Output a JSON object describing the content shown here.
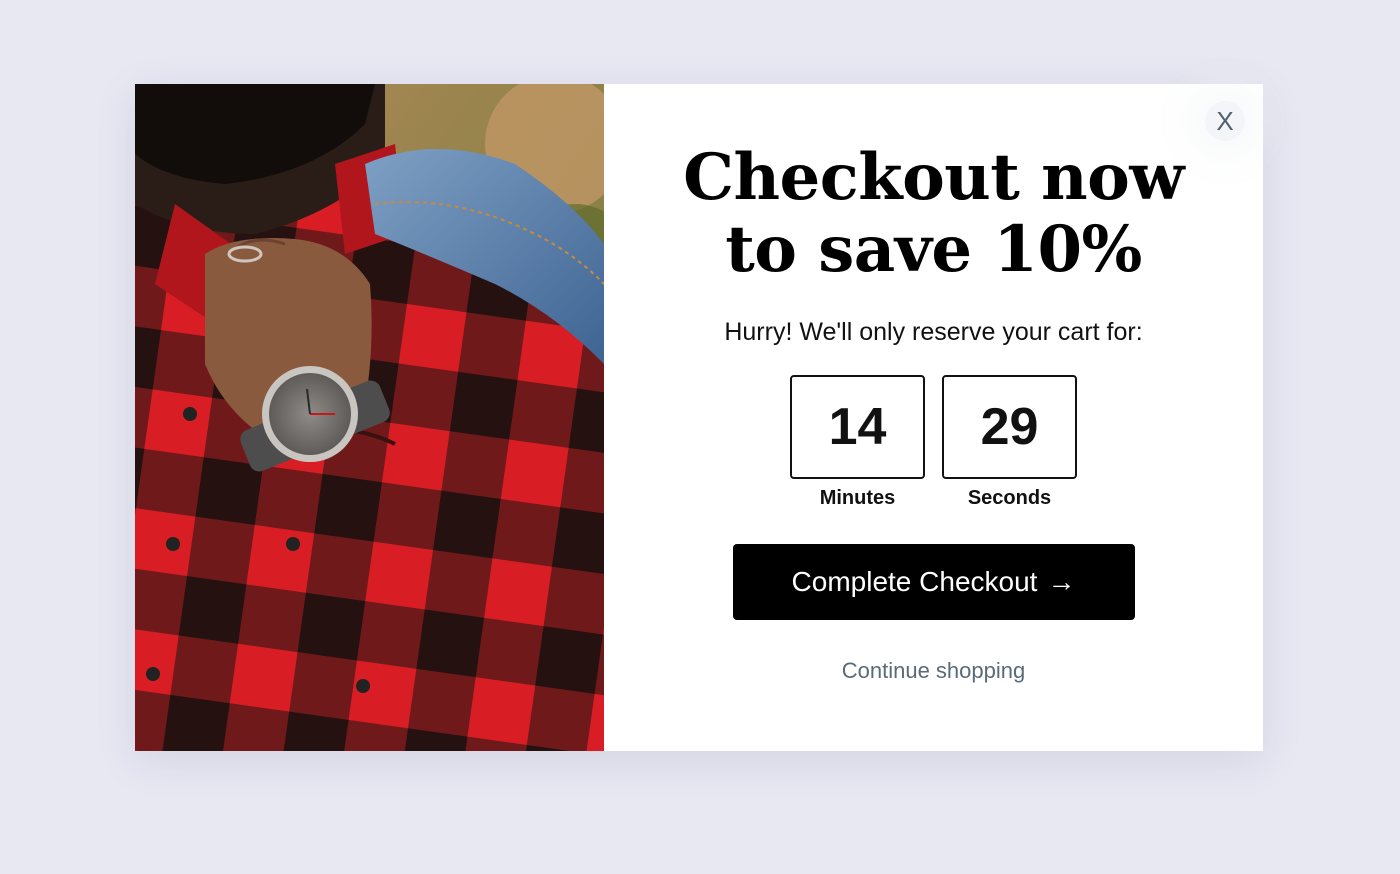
{
  "modal": {
    "headline": "Checkout now to save 10%",
    "subtext": "Hurry! We'll only reserve your cart for:",
    "close_label": "X",
    "timer": {
      "minutes": "14",
      "minutes_label": "Minutes",
      "seconds": "29",
      "seconds_label": "Seconds"
    },
    "cta_label": "Complete Checkout",
    "cta_arrow": "→",
    "secondary_link": "Continue shopping"
  },
  "colors": {
    "page_background": "#e7e8f2",
    "cta_background": "#000000",
    "link_text": "#5a6b78",
    "close_icon": "#51616f"
  },
  "image": {
    "subject": "man in red and black plaid flannel shirt wearing a watch, denim jacket over shoulder"
  }
}
